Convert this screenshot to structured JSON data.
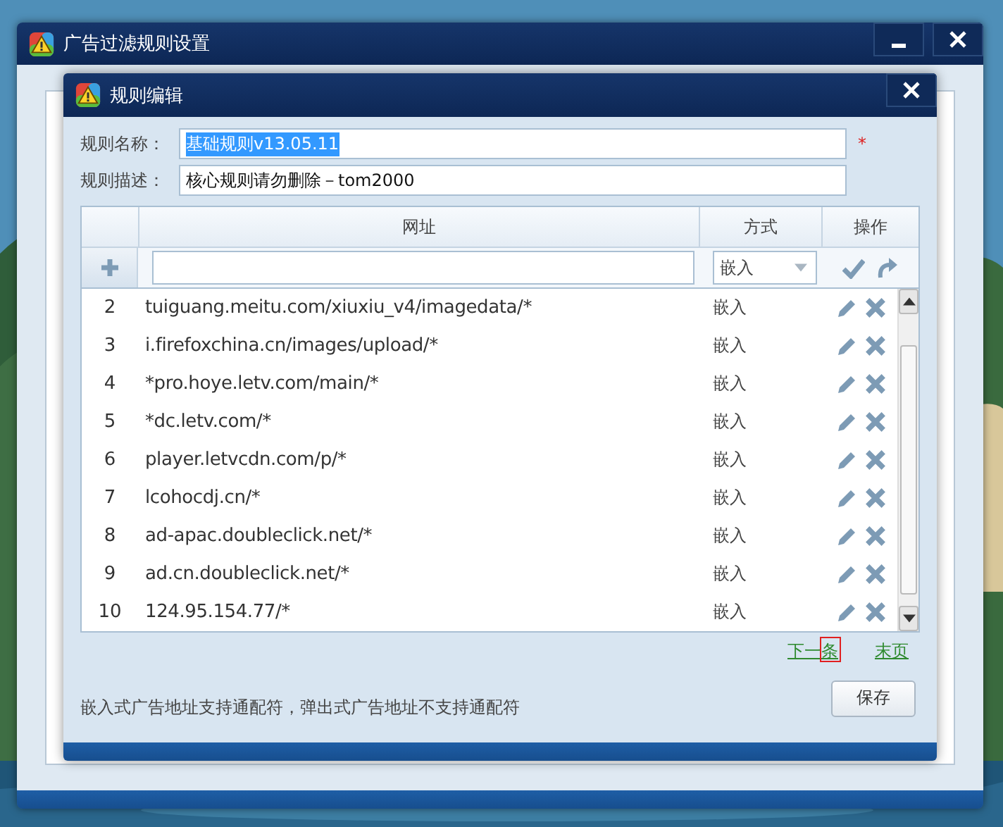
{
  "outer_window": {
    "title": "广告过滤规则设置"
  },
  "dialog": {
    "title": "规则编辑",
    "fields": [
      {
        "label": "规则名称：",
        "value": "基础规则v13.05.11",
        "selected": true,
        "required_mark": "*"
      },
      {
        "label": "规则描述：",
        "value": "核心规则请勿删除－tom2000",
        "selected": false
      }
    ],
    "table": {
      "columns": [
        "网址",
        "方式",
        "操作"
      ],
      "new_row": {
        "mode": "嵌入"
      },
      "rows": [
        {
          "index": "2",
          "url": "tuiguang.meitu.com/xiuxiu_v4/imagedata/*",
          "mode": "嵌入"
        },
        {
          "index": "3",
          "url": "i.firefoxchina.cn/images/upload/*",
          "mode": "嵌入"
        },
        {
          "index": "4",
          "url": "*pro.hoye.letv.com/main/*",
          "mode": "嵌入"
        },
        {
          "index": "5",
          "url": "*dc.letv.com/*",
          "mode": "嵌入"
        },
        {
          "index": "6",
          "url": "player.letvcdn.com/p/*",
          "mode": "嵌入"
        },
        {
          "index": "7",
          "url": "lcohocdj.cn/*",
          "mode": "嵌入"
        },
        {
          "index": "8",
          "url": "ad-apac.doubleclick.net/*",
          "mode": "嵌入"
        },
        {
          "index": "9",
          "url": "ad.cn.doubleclick.net/*",
          "mode": "嵌入"
        },
        {
          "index": "10",
          "url": "124.95.154.77/*",
          "mode": "嵌入"
        }
      ]
    },
    "pager": [
      {
        "label": "下一条",
        "marked": true
      },
      {
        "label": "末页",
        "marked": false
      }
    ],
    "note": "嵌入式广告地址支持通配符，弹出式广告地址不支持通配符",
    "save_button": "保存"
  }
}
